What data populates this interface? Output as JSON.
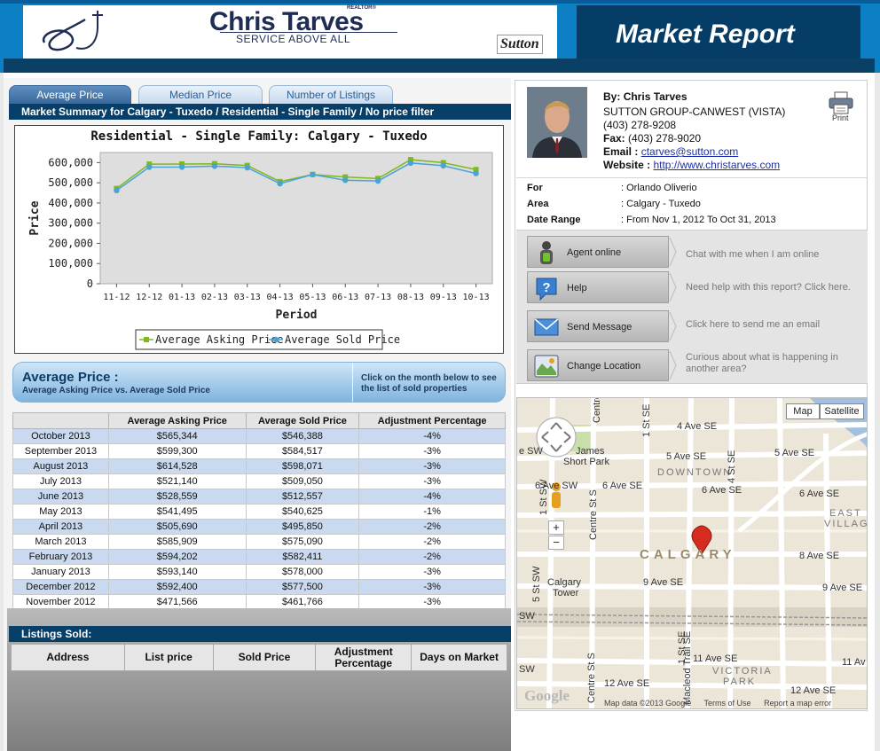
{
  "header": {
    "logo_name": "Chris Tarves",
    "logo_realtor": "REALTOR®",
    "logo_tagline": "SERVICE ABOVE ALL",
    "logo_brand": "Sutton",
    "report_title": "Market Report"
  },
  "tabs": [
    {
      "label": "Average Price",
      "active": true
    },
    {
      "label": "Median Price",
      "active": false
    },
    {
      "label": "Number of Listings",
      "active": false
    }
  ],
  "summary_title": "Market Summary for Calgary - Tuxedo / Residential - Single Family / No price filter",
  "chart_data": {
    "type": "line",
    "title": "Residential - Single Family: Calgary - Tuxedo",
    "xlabel": "Period",
    "ylabel": "Price",
    "categories": [
      "11-12",
      "12-12",
      "01-13",
      "02-13",
      "03-13",
      "04-13",
      "05-13",
      "06-13",
      "07-13",
      "08-13",
      "09-13",
      "10-13"
    ],
    "ylim": [
      0,
      650000
    ],
    "yticks": [
      0,
      100000,
      200000,
      300000,
      400000,
      500000,
      600000
    ],
    "ytick_labels": [
      "0",
      "100,000",
      "200,000",
      "300,000",
      "400,000",
      "500,000",
      "600,000"
    ],
    "grid": false,
    "legend_position": "bottom",
    "series": [
      {
        "name": "Average Asking Price",
        "color": "#7fb81f",
        "values": [
          471566,
          592400,
          593140,
          594202,
          585909,
          505690,
          541495,
          528559,
          521140,
          614528,
          599300,
          565344
        ]
      },
      {
        "name": "Average Sold Price",
        "color": "#4aa3d6",
        "values": [
          461766,
          577500,
          578000,
          582411,
          575090,
          495850,
          540625,
          512557,
          509050,
          598071,
          584517,
          546388
        ]
      }
    ]
  },
  "avg_banner": {
    "title": "Average Price :",
    "subtitle": "Average Asking Price vs. Average Sold Price",
    "hint": "Click on the month below to see the list of sold properties"
  },
  "price_table": {
    "headers": [
      "",
      "Average Asking Price",
      "Average Sold Price",
      "Adjustment Percentage"
    ],
    "rows": [
      [
        "October 2013",
        "$565,344",
        "$546,388",
        "-4%"
      ],
      [
        "September 2013",
        "$599,300",
        "$584,517",
        "-3%"
      ],
      [
        "August 2013",
        "$614,528",
        "$598,071",
        "-3%"
      ],
      [
        "July 2013",
        "$521,140",
        "$509,050",
        "-3%"
      ],
      [
        "June 2013",
        "$528,559",
        "$512,557",
        "-4%"
      ],
      [
        "May 2013",
        "$541,495",
        "$540,625",
        "-1%"
      ],
      [
        "April 2013",
        "$505,690",
        "$495,850",
        "-2%"
      ],
      [
        "March 2013",
        "$585,909",
        "$575,090",
        "-2%"
      ],
      [
        "February 2013",
        "$594,202",
        "$582,411",
        "-2%"
      ],
      [
        "January 2013",
        "$593,140",
        "$578,000",
        "-3%"
      ],
      [
        "December 2012",
        "$592,400",
        "$577,500",
        "-3%"
      ],
      [
        "November 2012",
        "$471,566",
        "$461,766",
        "-3%"
      ]
    ]
  },
  "listings": {
    "title": "Listings Sold:",
    "headers": [
      "Address",
      "List price",
      "Sold Price",
      "Adjustment Percentage",
      "Days on Market"
    ]
  },
  "agent": {
    "by_label": "By:",
    "name": "Chris Tarves",
    "company": "SUTTON GROUP-CANWEST (VISTA)",
    "phone": "(403) 278-9208",
    "fax_label": "Fax:",
    "fax": "(403) 278-9020",
    "email_label": "Email :",
    "email": "ctarves@sutton.com",
    "website_label": "Website :",
    "website": "http://www.christarves.com",
    "print_label": "Print"
  },
  "meta": {
    "for_label": "For",
    "for_value": ": Orlando Oliverio",
    "area_label": "Area",
    "area_value": ": Calgary - Tuxedo",
    "range_label": "Date Range",
    "range_value": ": From Nov 1, 2012 To Oct 31, 2013"
  },
  "actions": [
    {
      "label": "Agent online",
      "hint": "Chat with me when I am online",
      "icon": "agent-online-icon"
    },
    {
      "label": "Help",
      "hint": "Need help with this report? Click here.",
      "icon": "help-icon"
    },
    {
      "label": "Send Message",
      "hint": "Click here to send me an email",
      "icon": "envelope-icon"
    },
    {
      "label": "Change Location",
      "hint": "Curious about what is happening in another area?",
      "icon": "location-icon"
    }
  ],
  "map": {
    "type_map": "Map",
    "type_satellite": "Satellite",
    "google": "Google",
    "footer_data": "Map data ©2013 Google",
    "footer_terms": "Terms of Use",
    "footer_report": "Report a map error",
    "labels": {
      "l1": "4 Ave SE",
      "l2": "James",
      "l3": "Short Park",
      "l4": "5 Ave SE",
      "l5": "5 Ave SE",
      "l6": "6 Ave SW",
      "l7": "6 Ave SE",
      "l8": "DOWNTOWN",
      "l9": "6 Ave SE",
      "l10": "6 Ave SE",
      "l11": "EAST",
      "l12": "VILLAG",
      "l13": "8 Ave SE",
      "l14": "CALGARY",
      "l15": "Calgary",
      "l16": "Tower",
      "l17": "9 Ave SE",
      "l18": "9 Ave SE",
      "l19": "11 Ave SE",
      "l20": "11 Av",
      "l21": "VICTORIA",
      "l22": "PARK",
      "l23": "12 Ave SE",
      "l24": "12 Ave SE",
      "l25": "1 St SE",
      "l26": "1 St SE",
      "l27": "Centre St S",
      "l28": "Centre St S",
      "l29": "Macleod Trail SE",
      "l30": "4 St SE",
      "l31": "SW",
      "l32": "SW",
      "l33": "Centre",
      "l34": "5 St SW",
      "l35": "1 St SW",
      "l36": "e SW"
    }
  }
}
